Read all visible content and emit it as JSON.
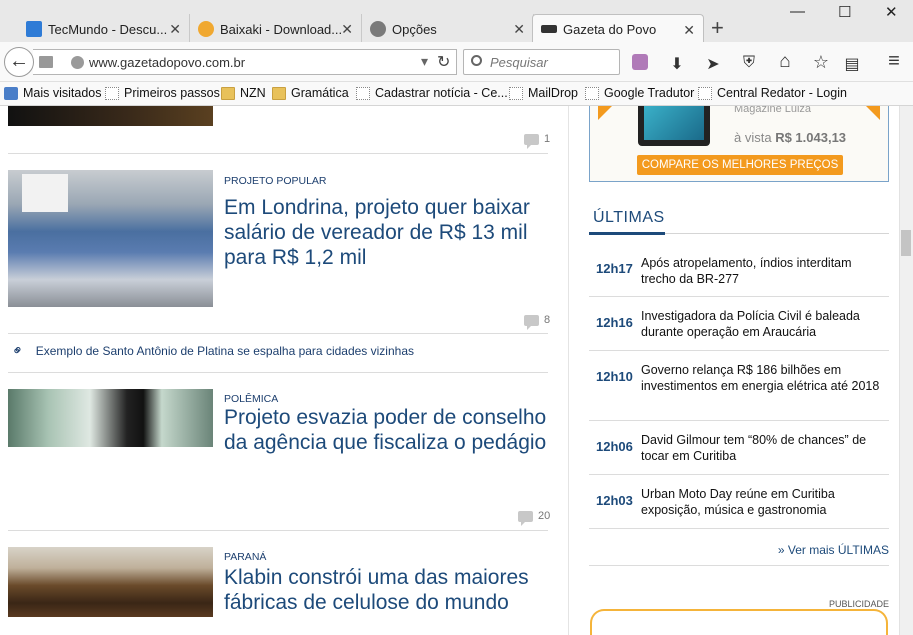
{
  "tabs": [
    {
      "label": "TecMundo - Descu...",
      "close": "✕",
      "color": "#2e7bd6"
    },
    {
      "label": "Baixaki - Download...",
      "close": "✕",
      "color": "#f0a830"
    },
    {
      "label": "Opções",
      "close": "✕",
      "color": "#7a7a7a"
    },
    {
      "label": "Gazeta do Povo",
      "close": "✕",
      "color": "#333333"
    }
  ],
  "window": {
    "minimize": "—",
    "maximize": "☐",
    "close": "✕",
    "newtab": "+"
  },
  "nav": {
    "back": "←",
    "url_host": "www.gazetadopovo.com.br",
    "dropdown": "▾",
    "reload": "↻",
    "search_placeholder": "Pesquisar"
  },
  "toolbar": {
    "download": "⬇",
    "send": "➤",
    "shield": "⛨",
    "home": "⌂",
    "star": "☆",
    "reader": "▤",
    "menu": "≡"
  },
  "bookmarks": [
    {
      "label": "Mais visitados",
      "kind": "star"
    },
    {
      "label": "Primeiros passos",
      "kind": "page"
    },
    {
      "label": "NZN",
      "kind": "folder"
    },
    {
      "label": "Gramática",
      "kind": "folder"
    },
    {
      "label": "Cadastrar notícia - Ce...",
      "kind": "page"
    },
    {
      "label": "MailDrop",
      "kind": "page"
    },
    {
      "label": "Google Tradutor",
      "kind": "page"
    },
    {
      "label": "Central Redator - Login",
      "kind": "page"
    }
  ],
  "feed": {
    "top_comments": "1",
    "articles": [
      {
        "kicker": "PROJETO POPULAR",
        "title": "Em Londrina, projeto quer baixar salário de vereador de R$ 13 mil para R$ 1,2 mil",
        "comments": "8"
      },
      {
        "kicker": "POLÊMICA",
        "title": "Projeto esvazia poder de conselho da agência que fiscaliza o pedágio",
        "comments": "20"
      },
      {
        "kicker": "PARANÁ",
        "title": "Klabin constrói uma das maiores fábricas de celulose do mundo"
      }
    ],
    "related": "Exemplo de Santo Antônio de Platina se espalha para cidades vizinhas"
  },
  "ad": {
    "store": "Magazine Luiza",
    "price_prefix": "à vista",
    "price": "R$ 1.043,13",
    "cta": "COMPARE OS MELHORES PREÇOS"
  },
  "ultimas": {
    "heading": "ÚLTIMAS",
    "items": [
      {
        "time": "12h17",
        "text": "Após atropelamento, índios interditam trecho da BR-277"
      },
      {
        "time": "12h16",
        "text": "Investigadora da Polícia Civil é baleada durante operação em Araucária"
      },
      {
        "time": "12h10",
        "text": "Governo relança R$ 186 bilhões em investimentos em energia elétrica até 2018"
      },
      {
        "time": "12h06",
        "text": "David Gilmour tem “80% de chances” de tocar em Curitiba"
      },
      {
        "time": "12h03",
        "text": "Urban Moto Day reúne em Curitiba exposição, música e gastronomia"
      }
    ],
    "more": "» Ver mais ÚLTIMAS"
  },
  "publicidade": "PUBLICIDADE"
}
